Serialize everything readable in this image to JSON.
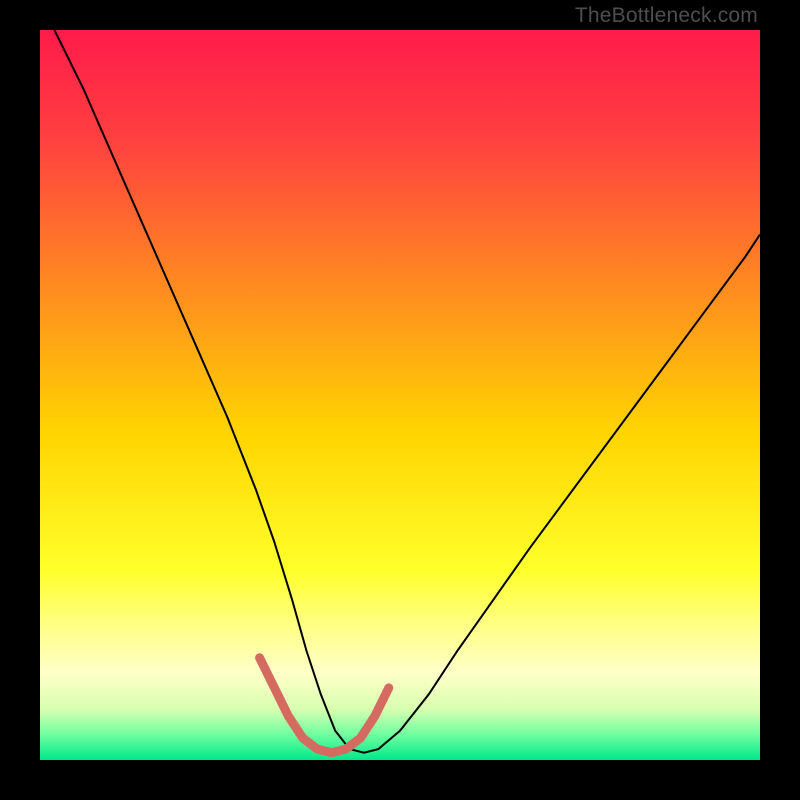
{
  "watermark": "TheBottleneck.com",
  "chart_data": {
    "type": "line",
    "title": "",
    "xlabel": "",
    "ylabel": "",
    "xlim": [
      0,
      100
    ],
    "ylim": [
      0,
      100
    ],
    "background_gradient": {
      "stops": [
        {
          "pos": 0.0,
          "color": "#ff1b4a"
        },
        {
          "pos": 0.15,
          "color": "#ff4040"
        },
        {
          "pos": 0.35,
          "color": "#ff8a20"
        },
        {
          "pos": 0.55,
          "color": "#ffd400"
        },
        {
          "pos": 0.74,
          "color": "#ffff2a"
        },
        {
          "pos": 0.82,
          "color": "#ffff8a"
        },
        {
          "pos": 0.88,
          "color": "#ffffc8"
        },
        {
          "pos": 0.93,
          "color": "#d8ffb0"
        },
        {
          "pos": 0.965,
          "color": "#70ffa0"
        },
        {
          "pos": 1.0,
          "color": "#00e88a"
        }
      ]
    },
    "series": [
      {
        "name": "bottleneck-curve",
        "color": "#000000",
        "width": 2,
        "x": [
          2,
          6,
          10,
          14,
          18,
          22,
          26,
          30,
          32.5,
          35,
          37,
          39,
          41,
          43,
          45,
          47,
          50,
          54,
          58,
          63,
          68,
          74,
          80,
          86,
          92,
          98,
          100
        ],
        "y": [
          100,
          92,
          83,
          74,
          65,
          56,
          47,
          37,
          30,
          22,
          15,
          9,
          4,
          1.5,
          1,
          1.5,
          4,
          9,
          15,
          22,
          29,
          37,
          45,
          53,
          61,
          69,
          72
        ]
      },
      {
        "name": "highlight-segment",
        "color": "#d46a60",
        "width": 9,
        "linecap": "round",
        "x": [
          30.5,
          32.5,
          34.5,
          36.5,
          38.5,
          40.5,
          42.5,
          44.5,
          46.5,
          48.5
        ],
        "y": [
          14,
          10,
          6,
          3,
          1.5,
          1,
          1.5,
          3,
          6,
          10
        ]
      }
    ]
  }
}
